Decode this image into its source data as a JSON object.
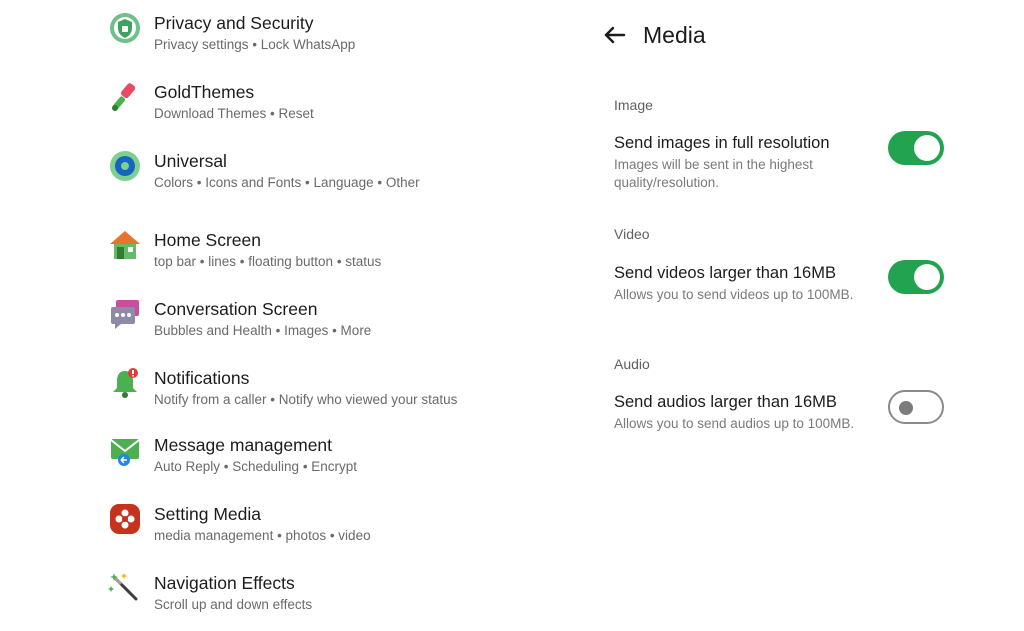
{
  "settings_menu": [
    {
      "title": "Privacy and Security",
      "subtitle": "Privacy settings • Lock WhatsApp",
      "icon": "shield-lock-icon"
    },
    {
      "title": "GoldThemes",
      "subtitle": "Download Themes • Reset",
      "icon": "paintbrush-icon"
    },
    {
      "title": "Universal",
      "subtitle": "Colors • Icons and Fonts • Language • Other",
      "icon": "gear-icon"
    },
    {
      "title": "Home Screen",
      "subtitle": "top bar • lines • floating button • status",
      "icon": "house-icon"
    },
    {
      "title": "Conversation Screen",
      "subtitle": "Bubbles and Health • Images • More",
      "icon": "chat-bubbles-icon"
    },
    {
      "title": "Notifications",
      "subtitle": "Notify from a caller • Notify who viewed your status",
      "icon": "bell-icon"
    },
    {
      "title": "Message management",
      "subtitle": "Auto Reply • Scheduling • Encrypt",
      "icon": "envelope-icon"
    },
    {
      "title": "Setting Media",
      "subtitle": "media management • photos • video",
      "icon": "flower-icon"
    },
    {
      "title": "Navigation Effects",
      "subtitle": "Scroll up and down effects",
      "icon": "magic-wand-icon"
    }
  ],
  "media_page": {
    "title": "Media",
    "back_icon": "arrow-left-icon",
    "sections": [
      {
        "header": "Image",
        "pref_title": "Send images in full resolution",
        "pref_subtitle": "Images will be sent in the highest quality/resolution.",
        "enabled": true
      },
      {
        "header": "Video",
        "pref_title": "Send videos larger than 16MB",
        "pref_subtitle": "Allows you to send videos up to 100MB.",
        "enabled": true
      },
      {
        "header": "Audio",
        "pref_title": "Send audios larger than 16MB",
        "pref_subtitle": "Allows you to send audios up to 100MB.",
        "enabled": false
      }
    ]
  },
  "colors": {
    "toggle_on": "#21a350",
    "toggle_off_border": "#8a8a8a"
  }
}
